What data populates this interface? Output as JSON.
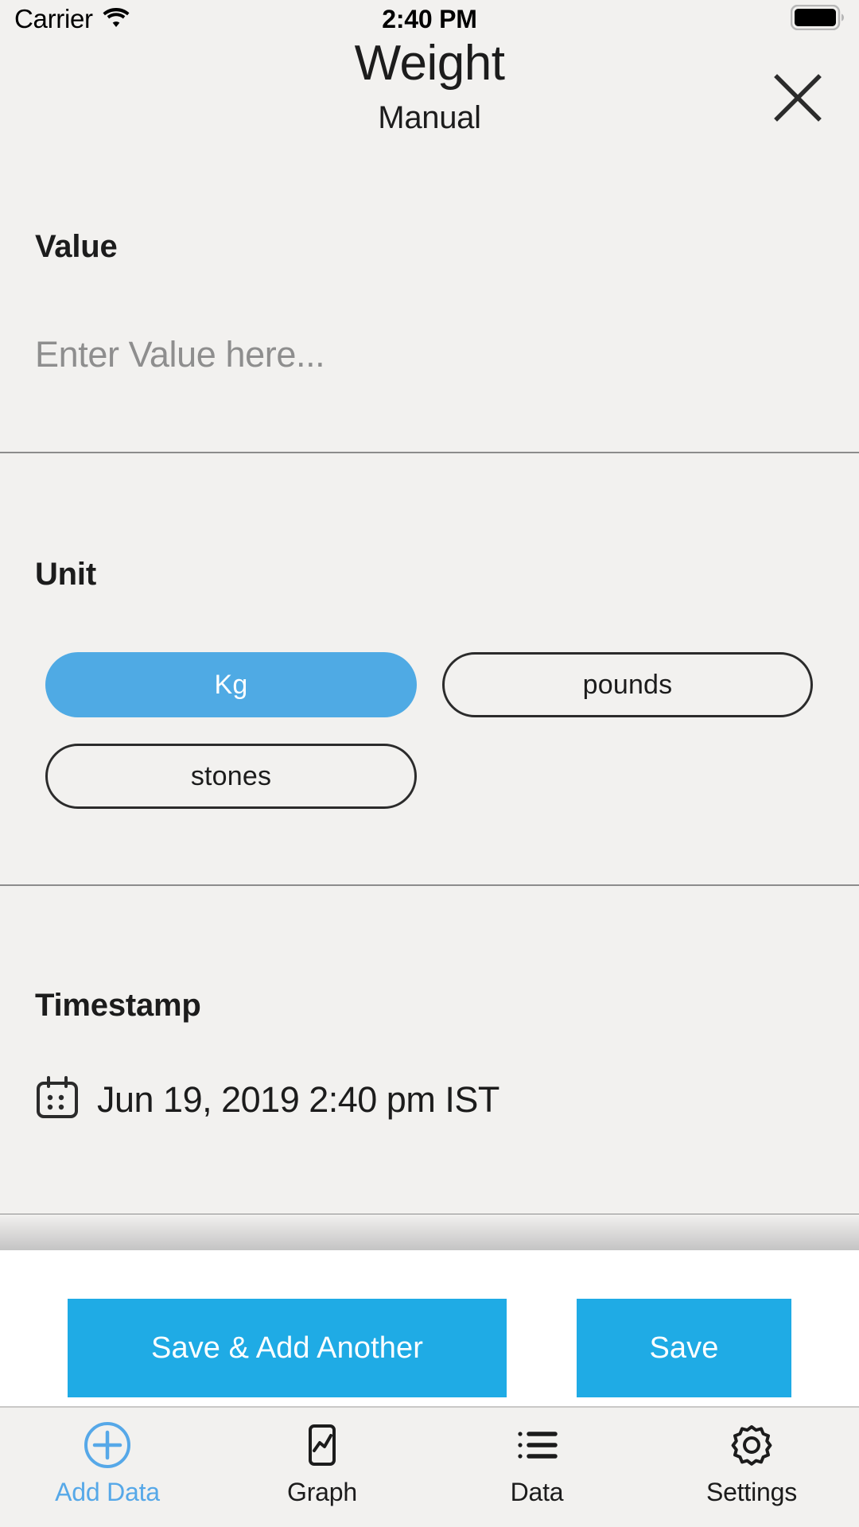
{
  "statusbar": {
    "carrier": "Carrier",
    "wifi_icon": "wifi-icon",
    "time": "2:40 PM",
    "battery_icon": "battery-full-icon"
  },
  "header": {
    "title": "Weight",
    "subtitle": "Manual",
    "close_icon": "close-icon"
  },
  "value_section": {
    "label": "Value",
    "input_value": "",
    "input_placeholder": "Enter Value here..."
  },
  "unit_section": {
    "label": "Unit",
    "options": [
      {
        "label": "Kg",
        "selected": true
      },
      {
        "label": "pounds",
        "selected": false
      },
      {
        "label": "stones",
        "selected": false
      }
    ]
  },
  "timestamp_section": {
    "label": "Timestamp",
    "calendar_icon": "calendar-icon",
    "value": "Jun 19, 2019 2:40 pm IST"
  },
  "actions": {
    "save_and_add_another": "Save & Add Another",
    "save": "Save"
  },
  "tabbar": {
    "tabs": [
      {
        "label": "Add Data",
        "icon": "plus-circle-icon",
        "active": true
      },
      {
        "label": "Graph",
        "icon": "chart-phone-icon",
        "active": false
      },
      {
        "label": "Data",
        "icon": "list-icon",
        "active": false
      },
      {
        "label": "Settings",
        "icon": "gear-icon",
        "active": false
      }
    ]
  },
  "colors": {
    "accent_blue": "#1fabe5",
    "pill_blue": "#4faae4",
    "tab_active_blue": "#56a8e8",
    "background": "#f2f1ef",
    "text": "#1c1c1c",
    "placeholder": "#8e8e8e"
  }
}
